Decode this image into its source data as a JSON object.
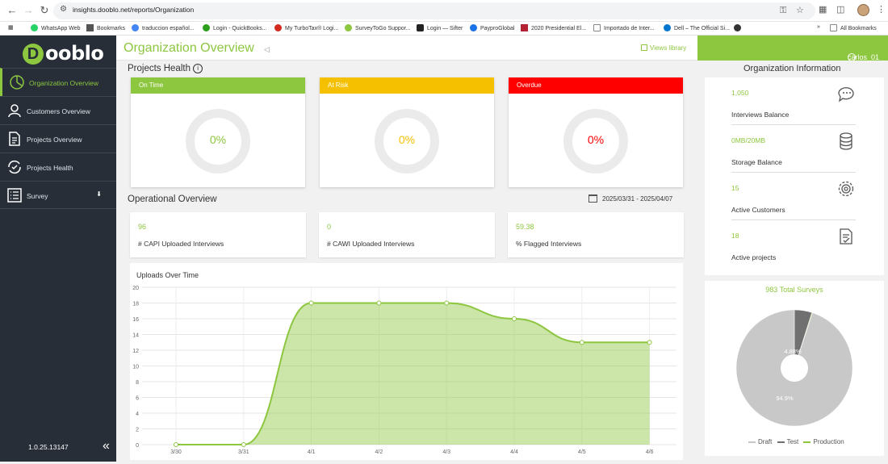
{
  "browser": {
    "url": "insights.dooblo.net/reports/Organization",
    "bookmarks": [
      {
        "label": "WhatsApp Web",
        "color": "#25d366"
      },
      {
        "label": "Bookmarks",
        "color": "#555555"
      },
      {
        "label": "traduccion español...",
        "color": "#4285f4"
      },
      {
        "label": "Login - QuickBooks...",
        "color": "#2ca01c"
      },
      {
        "label": "My TurboTax® Logi...",
        "color": "#d52b1e"
      },
      {
        "label": "SurveyToGo Suppor...",
        "color": "#8dc63f"
      },
      {
        "label": "Login — Sifter",
        "color": "#222222"
      },
      {
        "label": "PayproGlobal",
        "color": "#1a73e8"
      },
      {
        "label": "2020 Presidential El...",
        "color": "#b22234"
      },
      {
        "label": "Importado de Inter...",
        "color": "#888888"
      },
      {
        "label": "Dell – The Official Si...",
        "color": "#0076ce"
      }
    ],
    "all_bookmarks": "All Bookmarks"
  },
  "sidebar": {
    "logo": "Dooblo",
    "items": [
      {
        "label": "Organization Overview",
        "icon": "pie-icon"
      },
      {
        "label": "Customers Overview",
        "icon": "user-icon"
      },
      {
        "label": "Projects Overview",
        "icon": "document-icon"
      },
      {
        "label": "Projects Health",
        "icon": "refresh-check-icon"
      },
      {
        "label": "Survey",
        "icon": "list-icon"
      }
    ],
    "version": "1.0.25.13147"
  },
  "header": {
    "title": "Organization Overview",
    "views_library": "Views library",
    "user": "carlos_01"
  },
  "projects_health": {
    "title": "Projects Health",
    "cards": [
      {
        "label": "On Time",
        "value": "0%",
        "color": "#8dc63f"
      },
      {
        "label": "At Risk",
        "value": "0%",
        "color": "#f5c000"
      },
      {
        "label": "Overdue",
        "value": "0%",
        "color": "#ff0000"
      }
    ]
  },
  "operational": {
    "title": "Operational Overview",
    "date_range": "2025/03/31 - 2025/04/07",
    "stats": [
      {
        "value": "96",
        "label": "# CAPI Uploaded Interviews"
      },
      {
        "value": "0",
        "label": "# CAWI Uploaded Interviews"
      },
      {
        "value": "59.38",
        "label": "% Flagged Interviews"
      }
    ]
  },
  "uploads_chart": {
    "title": "Uploads Over Time"
  },
  "org_info": {
    "title": "Organization Information",
    "items": [
      {
        "value": "1,050",
        "label": "Interviews Balance",
        "icon": "chat-icon"
      },
      {
        "value": "0MB/20MB",
        "label": "Storage Balance",
        "icon": "database-icon"
      },
      {
        "value": "15",
        "label": "Active Customers",
        "icon": "gear-icon"
      },
      {
        "value": "18",
        "label": "Active projects",
        "icon": "checklist-icon"
      }
    ]
  },
  "surveys_pie": {
    "title": "983 Total Surveys",
    "label_small": "4.88%",
    "label_large": "94.9%",
    "legend": [
      "Draft",
      "Test",
      "Production"
    ]
  },
  "colors": {
    "accent": "#8dc63f",
    "sidebar": "#272e38"
  },
  "chart_data": [
    {
      "type": "area",
      "title": "Uploads Over Time",
      "x": [
        "3/30",
        "3/31",
        "4/1",
        "4/2",
        "4/3",
        "4/4",
        "4/5",
        "4/6"
      ],
      "values": [
        0,
        0,
        18,
        18,
        18,
        16,
        13,
        13
      ],
      "yticks": [
        0,
        2,
        4,
        6,
        8,
        10,
        12,
        14,
        16,
        18,
        20
      ],
      "ylim": [
        0,
        20
      ],
      "grid": true,
      "color": "#8dc63f"
    },
    {
      "type": "pie",
      "title": "983 Total Surveys",
      "labels": [
        "Draft",
        "Test",
        "Production"
      ],
      "values": [
        94.9,
        4.88,
        0.2
      ],
      "colors": [
        "#c8c8c8",
        "#707070",
        "#8dc63f"
      ],
      "donut": true,
      "legend": "bottom"
    }
  ]
}
